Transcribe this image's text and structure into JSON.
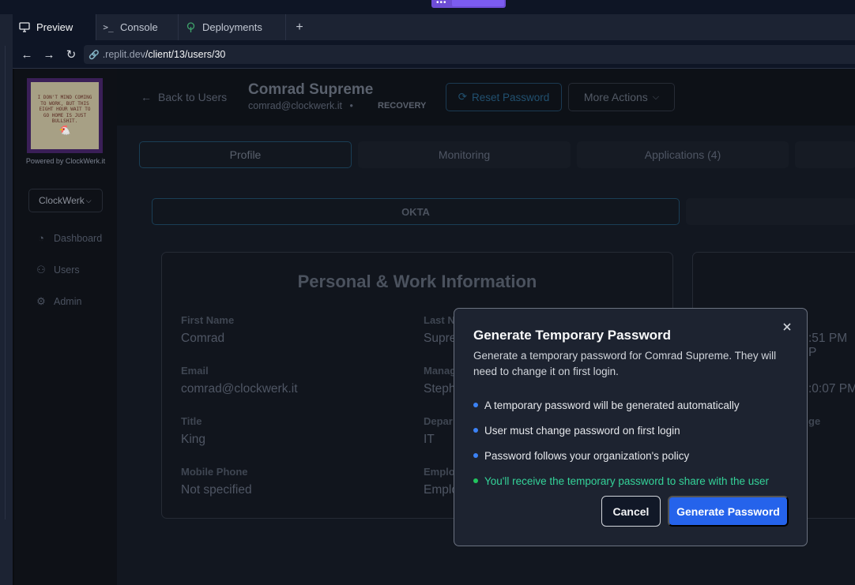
{
  "ide": {
    "tabs": [
      {
        "label": "Preview",
        "icon": "monitor-icon"
      },
      {
        "label": "Console",
        "icon": "terminal-icon"
      },
      {
        "label": "Deployments",
        "icon": "deploy-icon"
      }
    ],
    "add_tab": "+",
    "url": {
      "host": ".replit.dev",
      "path": "/client/13/users/30"
    }
  },
  "sidebar": {
    "logo_text": "I DON'T MIND COMING TO WORK, BUT THIS EIGHT HOUR WAIT TO GO HOME IS JUST BULLSHIT.",
    "powered_by": "Powered by ClockWerk.it",
    "org_select": "ClockWerk",
    "items": [
      {
        "label": "Dashboard",
        "icon": "gauge-icon"
      },
      {
        "label": "Users",
        "icon": "users-icon"
      },
      {
        "label": "Admin",
        "icon": "gear-icon"
      }
    ]
  },
  "header": {
    "back_label": "Back to Users",
    "user_name": "Comrad Supreme",
    "user_email": "comrad@clockwerk.it",
    "separator": "•",
    "user_status": "RECOVERY",
    "reset_password": "Reset Password",
    "more_actions": "More Actions"
  },
  "main_tabs": [
    "Profile",
    "Monitoring",
    "Applications (4)"
  ],
  "sub_tabs": [
    "OKTA"
  ],
  "card": {
    "title": "Personal & Work Information",
    "fields": [
      {
        "label": "First Name",
        "value": "Comrad"
      },
      {
        "label": "Last N",
        "value": "Supre"
      },
      {
        "label": "Email",
        "value": "comrad@clockwerk.it"
      },
      {
        "label": "Manag",
        "value": "Steph"
      },
      {
        "label": "Title",
        "value": "King"
      },
      {
        "label": "Depar",
        "value": "IT"
      },
      {
        "label": "Mobile Phone",
        "value": "Not specified"
      },
      {
        "label": "Emplo",
        "value": "Emplo"
      }
    ]
  },
  "card2": {
    "line1": ":51 PM P",
    "line2": ":0:07 PM",
    "line3": "ge"
  },
  "modal": {
    "title": "Generate Temporary Password",
    "description": "Generate a temporary password for Comrad Supreme. They will need to change it on first login.",
    "bullets": [
      "A temporary password will be generated automatically",
      "User must change password on first login",
      "Password follows your organization's policy"
    ],
    "note": "You'll receive the temporary password to share with the user",
    "cancel": "Cancel",
    "confirm": "Generate Password",
    "close_icon": "close-icon"
  },
  "colors": {
    "accent": "#2563eb",
    "success": "#34d399",
    "bullet": "#3b82f6"
  }
}
